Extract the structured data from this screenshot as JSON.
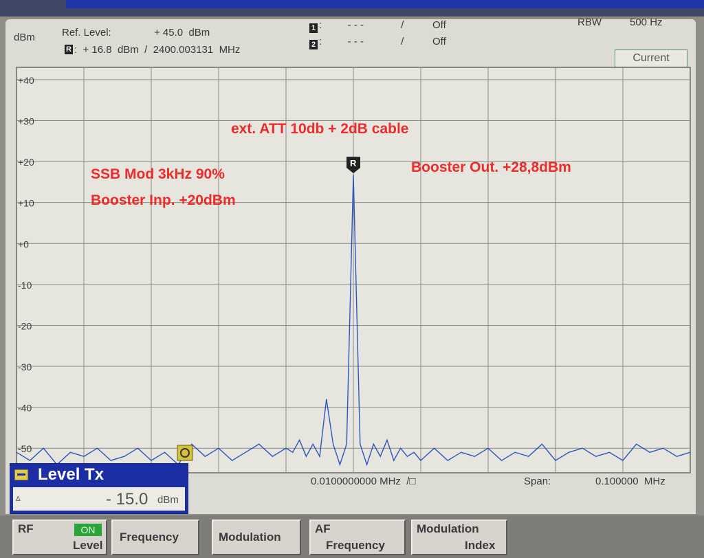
{
  "header": {
    "unit": "dBm",
    "ref_level_label": "Ref. Level:",
    "ref_level_value": "+ 45.0  dBm",
    "ref_marker_icon": "R",
    "ref_marker_reading": ":  + 16.8  dBm  /  2400.003131  MHz",
    "marker1_icon": "1",
    "marker1_text": ":         - - -             /          Off",
    "marker2_icon": "2",
    "marker2_text": ":         - - -             /          Off",
    "rbw_label": "RBW",
    "rbw_value": "500 Hz",
    "current_tab": "Current"
  },
  "chart_data": {
    "type": "line",
    "y_tick_labels": [
      "+40",
      "+30",
      "+20",
      "+10",
      "+0",
      "-10",
      "-20",
      "-30",
      "-40",
      "-50"
    ],
    "ylim": [
      -56,
      43
    ],
    "xlim": [
      -50,
      50
    ],
    "x_unit_note": "kHz offset from center",
    "grid": true,
    "peak": {
      "x": 0,
      "y": 16.8,
      "marker": "R"
    },
    "trace_color": "#2f53bf",
    "series": [
      {
        "x": [
          -50,
          -48,
          -46,
          -44,
          -42,
          -40,
          -38,
          -36,
          -34,
          -32,
          -30,
          -28,
          -26,
          -24,
          -22,
          -20,
          -18,
          -16,
          -14,
          -12,
          -10,
          -9,
          -8,
          -7,
          -6,
          -5,
          -4,
          -3,
          -2,
          -1,
          0,
          1,
          2,
          3,
          4,
          5,
          6,
          7,
          8,
          9,
          10,
          12,
          14,
          16,
          18,
          20,
          22,
          24,
          26,
          28,
          30,
          32,
          34,
          36,
          38,
          40,
          42,
          44,
          46,
          48,
          50
        ],
        "y": [
          -51,
          -53,
          -50,
          -54,
          -51,
          -52,
          -50,
          -53,
          -52,
          -50,
          -53,
          -51,
          -54,
          -49,
          -52,
          -50,
          -53,
          -51,
          -49,
          -52,
          -50,
          -51,
          -48,
          -52,
          -49,
          -52,
          -38,
          -49,
          -54,
          -49,
          16.8,
          -49,
          -54,
          -49,
          -52,
          -48,
          -53,
          -50,
          -52,
          -51,
          -53,
          -50,
          -53,
          -51,
          -52,
          -50,
          -53,
          -51,
          -52,
          -49,
          -53,
          -51,
          -50,
          -52,
          -51,
          -53,
          -49,
          -51,
          -50,
          -52,
          -51
        ]
      }
    ]
  },
  "annotations": {
    "att": "ext. ATT 10db + 2dB cable",
    "ssb": "SSB Mod 3kHz 90%",
    "booster_in": "Booster Inp. +20dBm",
    "booster_out": "Booster Out. +28,8dBm"
  },
  "footer": {
    "center": "0.0100000000 MHz  /□",
    "span_label": "Span:",
    "span_value": "0.100000  MHz"
  },
  "level_tx": {
    "title": "Level Tx",
    "small": "Δ",
    "value": "- 15.0",
    "unit": "dBm"
  },
  "softkeys": {
    "rf_label": "RF",
    "rf_on": "ON",
    "rf_level": "Level",
    "frequency": "Frequency",
    "modulation": "Modulation",
    "af_label": "AF",
    "af_frequency": "Frequency",
    "mod_index_1": "Modulation",
    "mod_index_2": "Index"
  }
}
